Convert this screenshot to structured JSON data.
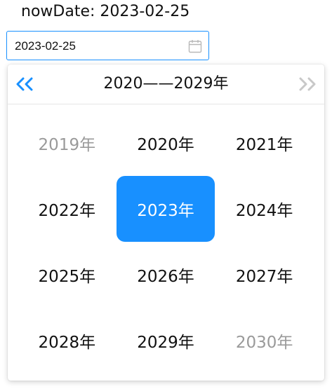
{
  "header": {
    "now_date_label": "nowDate: 2023-02-25"
  },
  "date_picker": {
    "input_value": "2023-02-25",
    "icon": "calendar-icon"
  },
  "panel": {
    "title": "2020——2029年",
    "prev_icon": "double-chevron-left-icon",
    "next_icon": "double-chevron-right-icon",
    "accent_color": "#1890ff",
    "disabled_color": "#c0c4cc",
    "years": [
      {
        "label": "2019年",
        "state": "other-decade"
      },
      {
        "label": "2020年",
        "state": "normal"
      },
      {
        "label": "2021年",
        "state": "normal"
      },
      {
        "label": "2022年",
        "state": "normal"
      },
      {
        "label": "2023年",
        "state": "selected"
      },
      {
        "label": "2024年",
        "state": "normal"
      },
      {
        "label": "2025年",
        "state": "normal"
      },
      {
        "label": "2026年",
        "state": "normal"
      },
      {
        "label": "2027年",
        "state": "normal"
      },
      {
        "label": "2028年",
        "state": "normal"
      },
      {
        "label": "2029年",
        "state": "normal"
      },
      {
        "label": "2030年",
        "state": "other-decade"
      }
    ]
  }
}
